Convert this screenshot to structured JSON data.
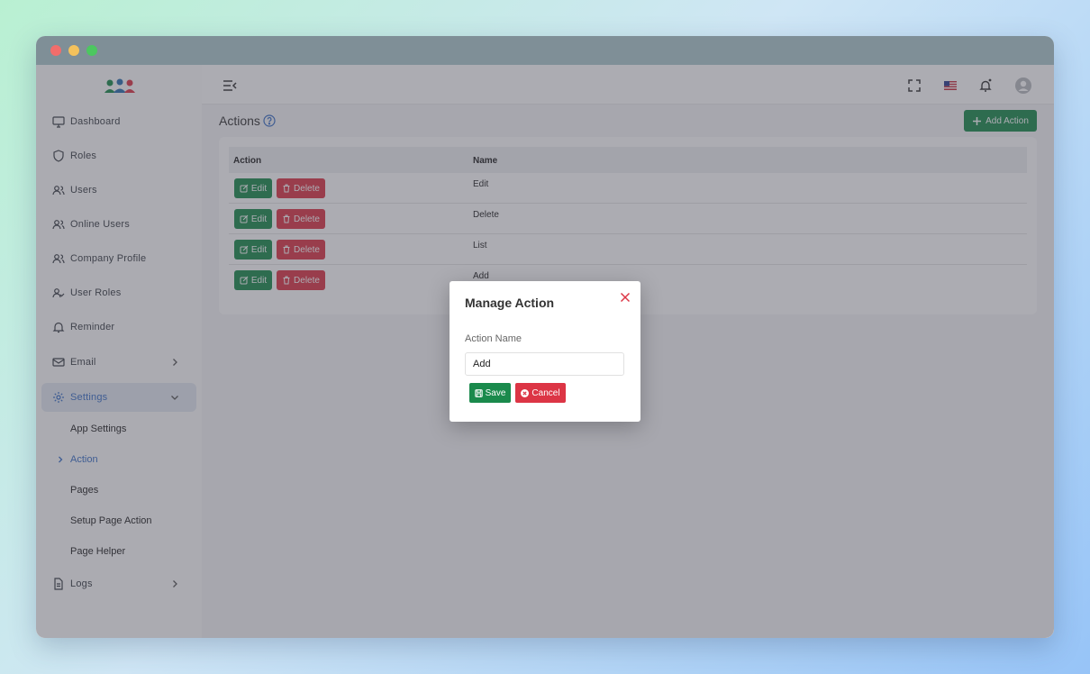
{
  "sidebar": {
    "items": [
      {
        "label": "Dashboard",
        "icon": "monitor-icon"
      },
      {
        "label": "Roles",
        "icon": "shield-icon"
      },
      {
        "label": "Users",
        "icon": "users-icon"
      },
      {
        "label": "Online Users",
        "icon": "users-icon"
      },
      {
        "label": "Company Profile",
        "icon": "users-icon"
      },
      {
        "label": "User Roles",
        "icon": "user-check-icon"
      },
      {
        "label": "Reminder",
        "icon": "bell-icon"
      },
      {
        "label": "Email",
        "icon": "mail-icon"
      },
      {
        "label": "Settings",
        "icon": "gear-icon"
      },
      {
        "label": "Logs",
        "icon": "file-icon"
      }
    ],
    "settings_sub": [
      "App Settings",
      "Action",
      "Pages",
      "Setup Page Action",
      "Page Helper"
    ]
  },
  "main": {
    "title": "Actions",
    "add_label": "Add Action",
    "table": {
      "headers": [
        "Action",
        "Name"
      ],
      "edit_label": "Edit",
      "delete_label": "Delete",
      "rows": [
        "Edit",
        "Delete",
        "List",
        "Add"
      ]
    }
  },
  "modal": {
    "title": "Manage Action",
    "field_label": "Action Name",
    "field_value": "Add",
    "save_label": "Save",
    "cancel_label": "Cancel"
  },
  "colors": {
    "green": "#1a8a4c",
    "red": "#dc3545",
    "accent": "#3a6fc7"
  }
}
